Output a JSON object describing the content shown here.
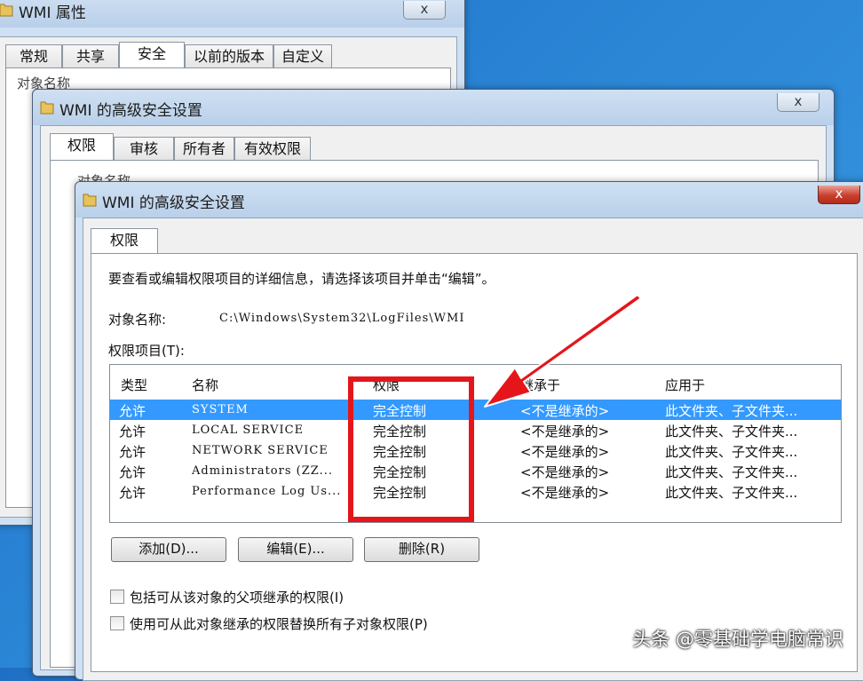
{
  "window1": {
    "title": "WMI 属性",
    "close": "x",
    "tabs": [
      "常规",
      "共享",
      "安全",
      "以前的版本",
      "自定义"
    ],
    "object_label_partial": "对象名称"
  },
  "window2": {
    "title": "WMI 的高级安全设置",
    "close": "x",
    "tabs": [
      "权限",
      "审核",
      "所有者",
      "有效权限"
    ],
    "object_label_partial": "对象名称"
  },
  "window3": {
    "title": "WMI 的高级安全设置",
    "close": "x",
    "tab": "权限",
    "instruction": "要查看或编辑权限项目的详细信息，请选择该项目并单击“编辑”。",
    "object_name_label": "对象名称:",
    "object_name_value": "C:\\Windows\\System32\\LogFiles\\WMI",
    "entries_label": "权限项目(T):",
    "columns": [
      "类型",
      "名称",
      "权限",
      "继承于",
      "应用于"
    ],
    "rows": [
      {
        "type": "允许",
        "name": "SYSTEM",
        "permission": "完全控制",
        "inherited": "<不是继承的>",
        "applies": "此文件夹、子文件夹..."
      },
      {
        "type": "允许",
        "name": "LOCAL SERVICE",
        "permission": "完全控制",
        "inherited": "<不是继承的>",
        "applies": "此文件夹、子文件夹..."
      },
      {
        "type": "允许",
        "name": "NETWORK SERVICE",
        "permission": "完全控制",
        "inherited": "<不是继承的>",
        "applies": "此文件夹、子文件夹..."
      },
      {
        "type": "允许",
        "name": "Administrators (ZZ...",
        "permission": "完全控制",
        "inherited": "<不是继承的>",
        "applies": "此文件夹、子文件夹..."
      },
      {
        "type": "允许",
        "name": "Performance Log Us...",
        "permission": "完全控制",
        "inherited": "<不是继承的>",
        "applies": "此文件夹、子文件夹..."
      }
    ],
    "buttons": {
      "add": "添加(D)...",
      "edit": "编辑(E)...",
      "remove": "删除(R)"
    },
    "checkbox_inherit": "包括可从该对象的父项继承的权限(I)",
    "checkbox_replace": "使用可从此对象继承的权限替换所有子对象权限(P)"
  },
  "watermark": "头条 @零基础学电脑常识",
  "colors": {
    "highlight": "#e4161a",
    "selection": "#3399ff"
  }
}
